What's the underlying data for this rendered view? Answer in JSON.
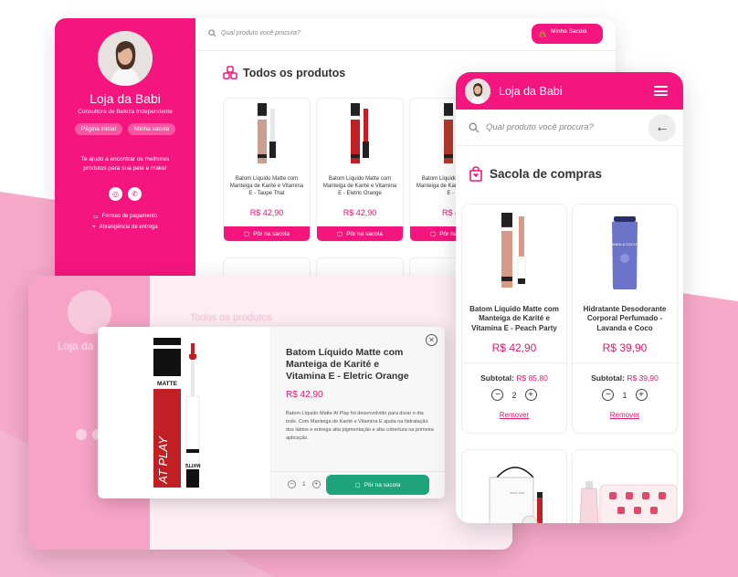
{
  "store": {
    "name": "Loja da Babi",
    "subtitle": "Consultora de Beleza Independente",
    "nav": [
      "Página inicial",
      "Minha sacola"
    ],
    "help": "Te ajudo a encontrar os melhores produtos para sua pele e make!",
    "links": [
      "Formas de pagamento",
      "Abrangência de entrega"
    ]
  },
  "search": {
    "placeholder": "Qual produto você procura?"
  },
  "cart_button": {
    "label": "Minha Sacola"
  },
  "desktop": {
    "section_title": "Todos os produtos",
    "products": [
      {
        "name": "Batom Líquido Matte com Manteiga de Karité e Vitamina E - Taupe That",
        "price": "R$ 42,90",
        "color": "#c9a08f"
      },
      {
        "name": "Batom Líquido Matte com Manteiga de Karité e Vitamina E - Eletric Orange",
        "price": "R$ 42,90",
        "color": "#c21f25"
      },
      {
        "name": "Batom Líquido Matte com Manteiga de Karité e Vitamina E - P",
        "price": "R$ 42",
        "color": "#b23a2c"
      }
    ],
    "add_label": "Pôr na sacola"
  },
  "modal_page_bg": {
    "store_name": "Loja da",
    "section_title": "Todos os produtos"
  },
  "modal": {
    "title": "Batom Líquido Matte com Manteiga de Karité e Vitamina E - Eletric Orange",
    "price": "R$ 42,90",
    "description": "Batom Líquido Matte At Play foi desenvolvido para durar o dia todo. Com Manteiga de Karité e Vitamina E ajuda na hidratação dos lábios e entrega alta pigmentação e alta cobertura na primeira aplicação.",
    "qty": "1",
    "add_label": "Pôr na sacola",
    "tube_text": "MATTE",
    "brand_text": "AT PLAY",
    "color": "#c21f25"
  },
  "mobile": {
    "title": "Loja da Babi",
    "search_placeholder": "Qual produto você procura?",
    "section_title": "Sacola de compras",
    "items": [
      {
        "name": "Batom Líquido Matte com Manteiga de Karité e Vitamina E - Peach Party",
        "price": "R$ 42,90",
        "subtotal_label": "Subtotal:",
        "subtotal": "R$ 85,80",
        "qty": "2",
        "remove": "Remover",
        "color": "#d79a86"
      },
      {
        "name": "Hidratante Desodorante Corporal Perfumado - Lavanda e Coco",
        "price": "R$ 39,90",
        "subtotal_label": "Subtotal:",
        "subtotal": "R$ 39,90",
        "qty": "1",
        "remove": "Remover",
        "label_text": "LAVANDA & COCONUT",
        "color": "#6c74c9"
      }
    ],
    "bag_text": "mary kay"
  },
  "colors": {
    "brand": "#f5157f",
    "price": "#e0196e",
    "success": "#1ea37b"
  }
}
